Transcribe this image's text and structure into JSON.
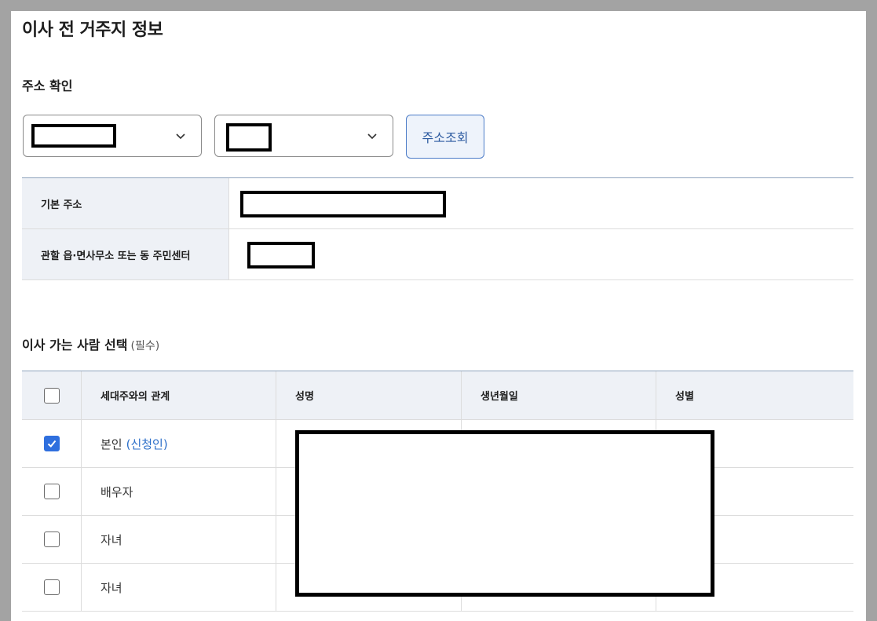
{
  "page": {
    "title": "이사 전 거주지 정보"
  },
  "address_check": {
    "title": "주소 확인",
    "lookup_button": "주소조회",
    "rows": [
      {
        "label": "기본 주소"
      },
      {
        "label": "관할 읍·면사무소 또는 동 주민센터"
      }
    ]
  },
  "movers": {
    "title": "이사 가는 사람 선택",
    "required": "(필수)",
    "columns": [
      "세대주와의 관계",
      "성명",
      "생년월일",
      "성별"
    ],
    "rows": [
      {
        "relation": "본인",
        "note": "(신청인)",
        "checked": true
      },
      {
        "relation": "배우자",
        "checked": false
      },
      {
        "relation": "자녀",
        "checked": false
      },
      {
        "relation": "자녀",
        "checked": false
      }
    ]
  },
  "colors": {
    "accent": "#2f6fde",
    "header_bg": "#eef1f6",
    "button_border": "#4b7bc7"
  },
  "icons": [
    "chevron-down-icon",
    "check-icon"
  ]
}
